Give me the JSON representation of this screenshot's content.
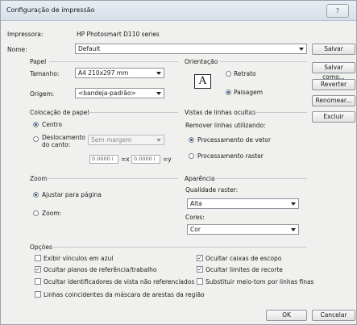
{
  "window": {
    "title": "Configuração de impressão",
    "help": "?"
  },
  "printer": {
    "label": "Impressora:",
    "value": "HP Photosmart D110 series"
  },
  "name": {
    "label": "Nome:",
    "value": "Default"
  },
  "paper": {
    "group": "Papel",
    "size_label": "Tamanho:",
    "size_value": "A4 210x297 mm",
    "source_label": "Origem:",
    "source_value": "<bandeja-padrão>"
  },
  "orientation": {
    "group": "Orientação",
    "portrait": "Retrato",
    "landscape": "Paisagem",
    "glyph": "A"
  },
  "placement": {
    "group": "Colocação de papel",
    "center": "Centro",
    "offset_line1": "Deslocamento",
    "offset_line2": "do canto:",
    "margin_value": "Sem margem",
    "x_value": "0.0000 i",
    "x_label": "=x",
    "y_value": "0.0000 i",
    "y_label": "=y"
  },
  "hidden_lines": {
    "group": "Vistas de linhas ocultas",
    "remove_label": "Remover linhas utilizando:",
    "vector": "Processamento de vetor",
    "raster": "Processamento raster"
  },
  "zoom": {
    "group": "Zoom",
    "fit": "Ajustar para página",
    "zoom": "Zoom:"
  },
  "appearance": {
    "group": "Aparência",
    "quality_label": "Qualidade raster:",
    "quality_value": "Alta",
    "colors_label": "Cores:",
    "colors_value": "Cor"
  },
  "options": {
    "group": "Opções",
    "items": [
      "Exibir vínculos em azul",
      "Ocultar planos de referência/trabalho",
      "Ocultar identificadores de vista não referenciados",
      "Linhas coincidentes da máscara de arestas da região",
      "Ocultar caixas de escopo",
      "Ocultar limites de recorte",
      "Substituir meio-tom por linhas finas"
    ]
  },
  "buttons": {
    "save": "Salvar",
    "save_as": "Salvar como...",
    "revert": "Reverter",
    "rename": "Renomear...",
    "delete": "Excluir",
    "ok": "OK",
    "cancel": "Cancelar"
  }
}
